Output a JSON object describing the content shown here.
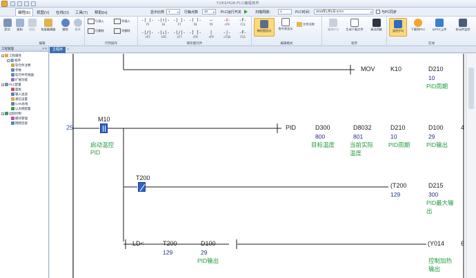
{
  "window": {
    "title": "YUKEHUA PLC编程软件"
  },
  "menu": {
    "items": [
      {
        "label": "编程(E)"
      },
      {
        "label": "视图(V)"
      },
      {
        "label": "在线(O)"
      },
      {
        "label": "工具(T)"
      },
      {
        "label": "帮助(H)"
      }
    ],
    "display_ratio_label": "显示比例",
    "display_ratio_value": "1",
    "row_points_label": "行触点数",
    "row_points_value": "10",
    "plc_run_label": "PLC运行开关",
    "scan_period_label": "扫描周期：",
    "scan_period_value": "1",
    "plc_time_label": "PLC时间：",
    "plc_time_value": "2019年1月1日 0:0:0",
    "time_sync_label": "与PC同步"
  },
  "ribbon": {
    "groups": [
      {
        "label": "编辑"
      },
      {
        "label": "行列操作"
      },
      {
        "label": "梯形图元件"
      },
      {
        "label": "编辑模式"
      },
      {
        "label": "程序"
      },
      {
        "label": "在线"
      }
    ],
    "edit_buttons": [
      "剪切",
      "复制",
      "粘贴",
      "恢复编辑器",
      "撤销",
      "重做"
    ],
    "row_buttons": [
      "行插入",
      "行删除",
      "列插入",
      "列删除"
    ],
    "ladder_symbols": [
      {
        "sym": "-| |-",
        "cap": "F5"
      },
      {
        "sym": "-|/|-",
        "cap": "sF5"
      },
      {
        "sym": "-|↑|-",
        "cap": "F6"
      },
      {
        "sym": "-|↓|-",
        "cap": "sF6"
      },
      {
        "sym": "-| |-",
        "cap": "F7"
      },
      {
        "sym": "-|/|-",
        "cap": "sF7"
      },
      {
        "sym": "-( )-",
        "cap": "F8"
      },
      {
        "sym": "-[ ]-",
        "cap": "sF8"
      },
      {
        "sym": "—",
        "cap": "F9"
      },
      {
        "sym": "|",
        "cap": "sF9"
      },
      {
        "sym": "-X-",
        "cap": "cF9"
      },
      {
        "sym": "-|-",
        "cap": "cF10"
      },
      {
        "sym": "-F-",
        "cap": "F11"
      },
      {
        "sym": "-F-",
        "cap": "F12"
      }
    ],
    "mode_buttons": [
      "梯形图显示",
      "指令表显示",
      "元件注释"
    ],
    "program_buttons": [
      "编译(F4)",
      "生成下载文件",
      "调试四路"
    ],
    "online_buttons": [
      "监控(F3)",
      "下载到PLC",
      "从PLC上传",
      "软元件监控"
    ]
  },
  "tree": {
    "header": "工程管理",
    "items": [
      "工程属性",
      "程序",
      "软元件注释",
      "参数",
      "软元件存储器",
      "扩展功能",
      "PLC配置",
      "面板",
      "输入滤波",
      "通信设置",
      "CAN总线",
      "以太网配置",
      "远程控制",
      "模块管理",
      "网络连接"
    ]
  },
  "editor": {
    "tab_label": "主程序",
    "rung_numbers": [
      "25"
    ],
    "right_labels": [
      "4",
      "6"
    ],
    "ladder": {
      "mov": {
        "op": "MOV",
        "src": "K10",
        "dst": "D210",
        "dst_val": "10",
        "dst_comment": "PID周期"
      },
      "m10": {
        "contact": "M10",
        "comment1": "启动温控",
        "comment2": "PID"
      },
      "pid": {
        "op": "PID",
        "p1": "D300",
        "p1_val": "800",
        "p1_c": "目标温度",
        "p2": "D8032",
        "p2_val": "801",
        "p2_c1": "当前实际",
        "p2_c2": "温度",
        "p3": "D210",
        "p3_val": "10",
        "p3_c": "PID周期",
        "p4": "D100",
        "p4_val": "29",
        "p4_c": "PID输出"
      },
      "t200": {
        "contact": "T200",
        "coil": "(T200",
        "coil_val": "129",
        "preset": "D215",
        "preset_val": "300",
        "preset_c1": "PID最大输",
        "preset_c2": "出"
      },
      "ld": {
        "op": "LD<",
        "a": "T200",
        "a_val": "129",
        "b": "D100",
        "b_val": "29",
        "b_c": "PID输出",
        "coil": "(Y014",
        "coil_c1": "控制加热",
        "coil_c2": "输出"
      }
    }
  }
}
